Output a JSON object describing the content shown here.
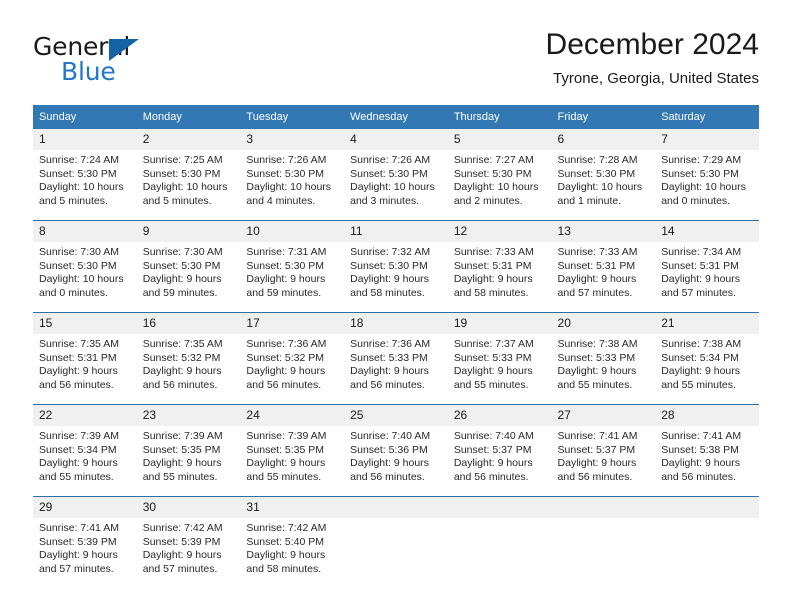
{
  "logo": {
    "primary_text": "General",
    "secondary_text": "Blue",
    "primary_color": "#1b1b1b",
    "secondary_color": "#2277c8",
    "triangle_color": "#1464a5"
  },
  "header": {
    "title": "December 2024",
    "subtitle": "Tyrone, Georgia, United States"
  },
  "colors": {
    "header_bar": "#3178b4",
    "row_separator": "#2f6fa8",
    "daynum_band": "#f0f0f0",
    "text": "#1a1a1a"
  },
  "weekday_headers": [
    "Sunday",
    "Monday",
    "Tuesday",
    "Wednesday",
    "Thursday",
    "Friday",
    "Saturday"
  ],
  "weeks": [
    [
      {
        "day": "1",
        "sunrise": "Sunrise: 7:24 AM",
        "sunset": "Sunset: 5:30 PM",
        "daylight": "Daylight: 10 hours and 5 minutes."
      },
      {
        "day": "2",
        "sunrise": "Sunrise: 7:25 AM",
        "sunset": "Sunset: 5:30 PM",
        "daylight": "Daylight: 10 hours and 5 minutes."
      },
      {
        "day": "3",
        "sunrise": "Sunrise: 7:26 AM",
        "sunset": "Sunset: 5:30 PM",
        "daylight": "Daylight: 10 hours and 4 minutes."
      },
      {
        "day": "4",
        "sunrise": "Sunrise: 7:26 AM",
        "sunset": "Sunset: 5:30 PM",
        "daylight": "Daylight: 10 hours and 3 minutes."
      },
      {
        "day": "5",
        "sunrise": "Sunrise: 7:27 AM",
        "sunset": "Sunset: 5:30 PM",
        "daylight": "Daylight: 10 hours and 2 minutes."
      },
      {
        "day": "6",
        "sunrise": "Sunrise: 7:28 AM",
        "sunset": "Sunset: 5:30 PM",
        "daylight": "Daylight: 10 hours and 1 minute."
      },
      {
        "day": "7",
        "sunrise": "Sunrise: 7:29 AM",
        "sunset": "Sunset: 5:30 PM",
        "daylight": "Daylight: 10 hours and 0 minutes."
      }
    ],
    [
      {
        "day": "8",
        "sunrise": "Sunrise: 7:30 AM",
        "sunset": "Sunset: 5:30 PM",
        "daylight": "Daylight: 10 hours and 0 minutes."
      },
      {
        "day": "9",
        "sunrise": "Sunrise: 7:30 AM",
        "sunset": "Sunset: 5:30 PM",
        "daylight": "Daylight: 9 hours and 59 minutes."
      },
      {
        "day": "10",
        "sunrise": "Sunrise: 7:31 AM",
        "sunset": "Sunset: 5:30 PM",
        "daylight": "Daylight: 9 hours and 59 minutes."
      },
      {
        "day": "11",
        "sunrise": "Sunrise: 7:32 AM",
        "sunset": "Sunset: 5:30 PM",
        "daylight": "Daylight: 9 hours and 58 minutes."
      },
      {
        "day": "12",
        "sunrise": "Sunrise: 7:33 AM",
        "sunset": "Sunset: 5:31 PM",
        "daylight": "Daylight: 9 hours and 58 minutes."
      },
      {
        "day": "13",
        "sunrise": "Sunrise: 7:33 AM",
        "sunset": "Sunset: 5:31 PM",
        "daylight": "Daylight: 9 hours and 57 minutes."
      },
      {
        "day": "14",
        "sunrise": "Sunrise: 7:34 AM",
        "sunset": "Sunset: 5:31 PM",
        "daylight": "Daylight: 9 hours and 57 minutes."
      }
    ],
    [
      {
        "day": "15",
        "sunrise": "Sunrise: 7:35 AM",
        "sunset": "Sunset: 5:31 PM",
        "daylight": "Daylight: 9 hours and 56 minutes."
      },
      {
        "day": "16",
        "sunrise": "Sunrise: 7:35 AM",
        "sunset": "Sunset: 5:32 PM",
        "daylight": "Daylight: 9 hours and 56 minutes."
      },
      {
        "day": "17",
        "sunrise": "Sunrise: 7:36 AM",
        "sunset": "Sunset: 5:32 PM",
        "daylight": "Daylight: 9 hours and 56 minutes."
      },
      {
        "day": "18",
        "sunrise": "Sunrise: 7:36 AM",
        "sunset": "Sunset: 5:33 PM",
        "daylight": "Daylight: 9 hours and 56 minutes."
      },
      {
        "day": "19",
        "sunrise": "Sunrise: 7:37 AM",
        "sunset": "Sunset: 5:33 PM",
        "daylight": "Daylight: 9 hours and 55 minutes."
      },
      {
        "day": "20",
        "sunrise": "Sunrise: 7:38 AM",
        "sunset": "Sunset: 5:33 PM",
        "daylight": "Daylight: 9 hours and 55 minutes."
      },
      {
        "day": "21",
        "sunrise": "Sunrise: 7:38 AM",
        "sunset": "Sunset: 5:34 PM",
        "daylight": "Daylight: 9 hours and 55 minutes."
      }
    ],
    [
      {
        "day": "22",
        "sunrise": "Sunrise: 7:39 AM",
        "sunset": "Sunset: 5:34 PM",
        "daylight": "Daylight: 9 hours and 55 minutes."
      },
      {
        "day": "23",
        "sunrise": "Sunrise: 7:39 AM",
        "sunset": "Sunset: 5:35 PM",
        "daylight": "Daylight: 9 hours and 55 minutes."
      },
      {
        "day": "24",
        "sunrise": "Sunrise: 7:39 AM",
        "sunset": "Sunset: 5:35 PM",
        "daylight": "Daylight: 9 hours and 55 minutes."
      },
      {
        "day": "25",
        "sunrise": "Sunrise: 7:40 AM",
        "sunset": "Sunset: 5:36 PM",
        "daylight": "Daylight: 9 hours and 56 minutes."
      },
      {
        "day": "26",
        "sunrise": "Sunrise: 7:40 AM",
        "sunset": "Sunset: 5:37 PM",
        "daylight": "Daylight: 9 hours and 56 minutes."
      },
      {
        "day": "27",
        "sunrise": "Sunrise: 7:41 AM",
        "sunset": "Sunset: 5:37 PM",
        "daylight": "Daylight: 9 hours and 56 minutes."
      },
      {
        "day": "28",
        "sunrise": "Sunrise: 7:41 AM",
        "sunset": "Sunset: 5:38 PM",
        "daylight": "Daylight: 9 hours and 56 minutes."
      }
    ],
    [
      {
        "day": "29",
        "sunrise": "Sunrise: 7:41 AM",
        "sunset": "Sunset: 5:39 PM",
        "daylight": "Daylight: 9 hours and 57 minutes."
      },
      {
        "day": "30",
        "sunrise": "Sunrise: 7:42 AM",
        "sunset": "Sunset: 5:39 PM",
        "daylight": "Daylight: 9 hours and 57 minutes."
      },
      {
        "day": "31",
        "sunrise": "Sunrise: 7:42 AM",
        "sunset": "Sunset: 5:40 PM",
        "daylight": "Daylight: 9 hours and 58 minutes."
      },
      {
        "day": "",
        "sunrise": "",
        "sunset": "",
        "daylight": ""
      },
      {
        "day": "",
        "sunrise": "",
        "sunset": "",
        "daylight": ""
      },
      {
        "day": "",
        "sunrise": "",
        "sunset": "",
        "daylight": ""
      },
      {
        "day": "",
        "sunrise": "",
        "sunset": "",
        "daylight": ""
      }
    ]
  ]
}
